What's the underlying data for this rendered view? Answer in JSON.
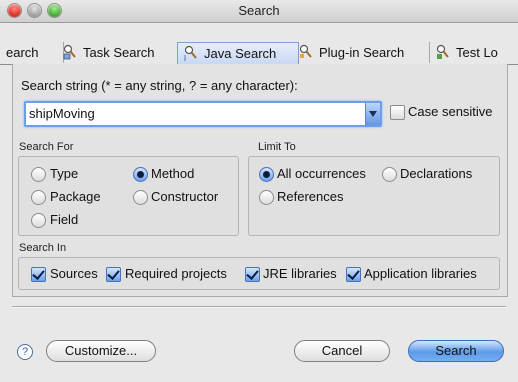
{
  "window": {
    "title": "Search"
  },
  "tabs": [
    {
      "label": "earch",
      "active": false
    },
    {
      "label": "Task Search",
      "active": false
    },
    {
      "label": "Java Search",
      "active": true
    },
    {
      "label": "Plug-in Search",
      "active": false
    },
    {
      "label": "Test Lo",
      "active": false
    }
  ],
  "search": {
    "label": "Search string (* = any string, ? = any character):",
    "value": "shipMoving",
    "case_sensitive_label": "Case sensitive",
    "case_sensitive": false
  },
  "search_for": {
    "title": "Search For",
    "options": [
      {
        "label": "Type",
        "checked": false
      },
      {
        "label": "Method",
        "checked": true
      },
      {
        "label": "Package",
        "checked": false
      },
      {
        "label": "Constructor",
        "checked": false
      },
      {
        "label": "Field",
        "checked": false
      }
    ]
  },
  "limit_to": {
    "title": "Limit To",
    "options": [
      {
        "label": "All occurrences",
        "checked": true
      },
      {
        "label": "Declarations",
        "checked": false
      },
      {
        "label": "References",
        "checked": false
      }
    ]
  },
  "search_in": {
    "title": "Search In",
    "options": [
      {
        "label": "Sources",
        "checked": true
      },
      {
        "label": "Required projects",
        "checked": true
      },
      {
        "label": "JRE libraries",
        "checked": true
      },
      {
        "label": "Application libraries",
        "checked": true
      }
    ]
  },
  "buttons": {
    "help": "?",
    "customize": "Customize...",
    "cancel": "Cancel",
    "search": "Search"
  },
  "colors": {
    "accent": "#6d9ee8",
    "primary_button": "#5d9be9"
  }
}
